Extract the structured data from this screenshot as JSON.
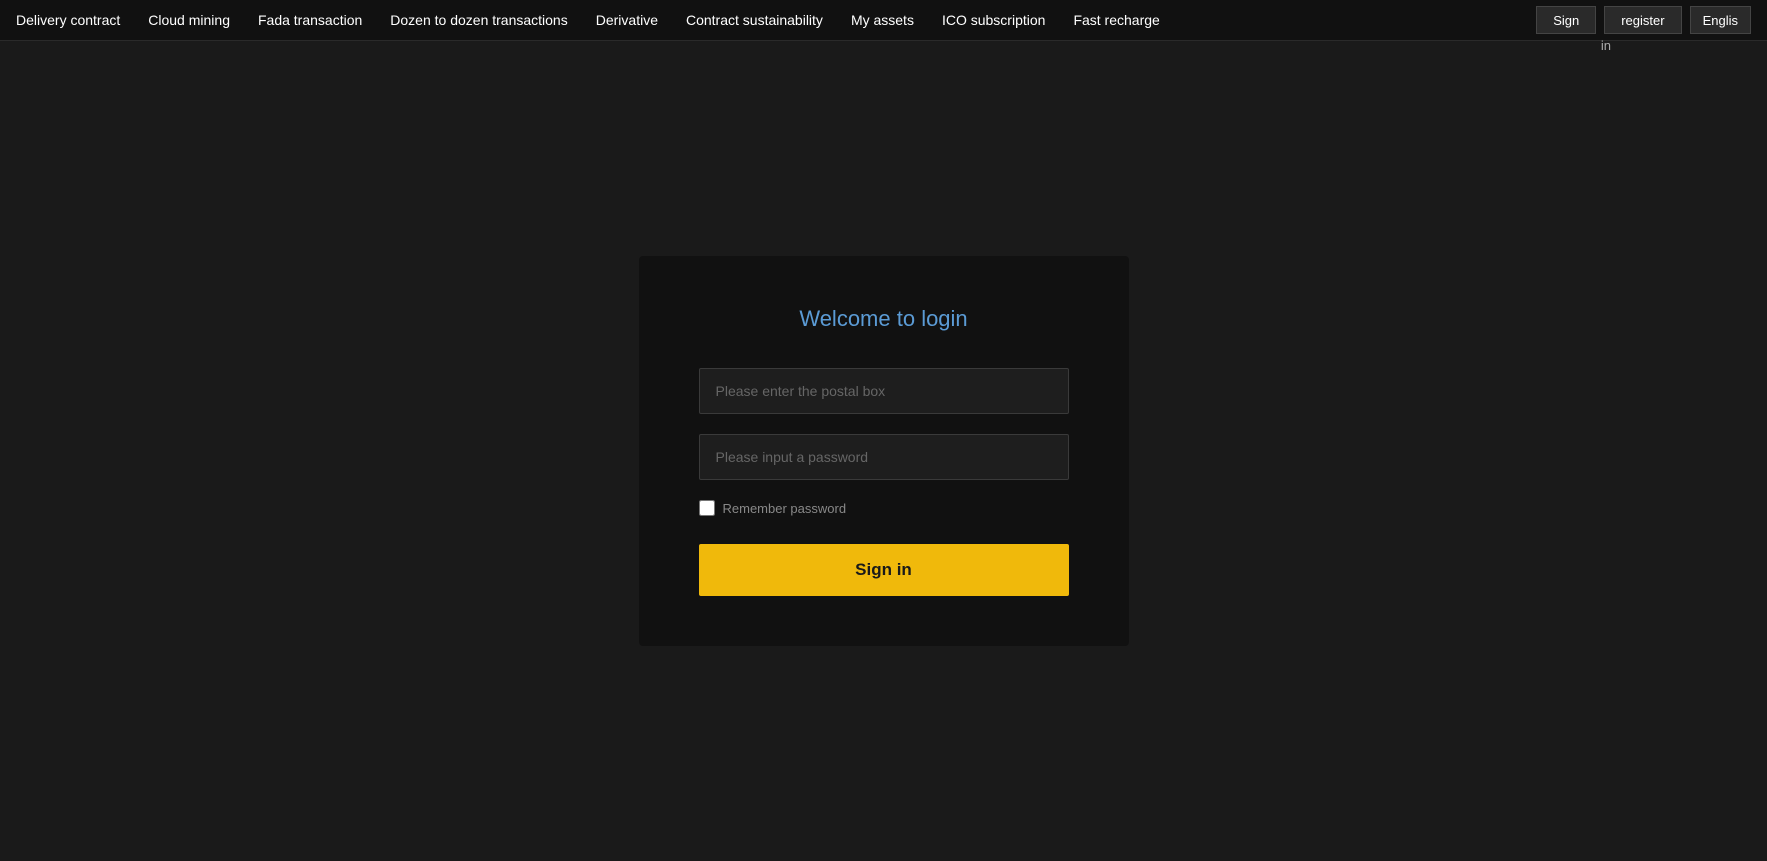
{
  "navbar": {
    "links": [
      {
        "label": "Delivery contract",
        "id": "delivery-contract"
      },
      {
        "label": "Cloud mining",
        "id": "cloud-mining"
      },
      {
        "label": "Fada transaction",
        "id": "fada-transaction"
      },
      {
        "label": "Dozen to dozen transactions",
        "id": "dozen-transactions"
      },
      {
        "label": "Derivative",
        "id": "derivative"
      },
      {
        "label": "Contract sustainability",
        "id": "contract-sustainability"
      },
      {
        "label": "My assets",
        "id": "my-assets"
      },
      {
        "label": "ICO subscription",
        "id": "ico-subscription"
      },
      {
        "label": "Fast recharge",
        "id": "fast-recharge"
      }
    ],
    "signin_label": "Sign",
    "signin_sub": "in",
    "register_label": "register",
    "language_label": "Englis"
  },
  "login": {
    "title": "Welcome to login",
    "email_placeholder": "Please enter the postal box",
    "password_placeholder": "Please input a password",
    "remember_label": "Remember password",
    "signin_button": "Sign in"
  }
}
